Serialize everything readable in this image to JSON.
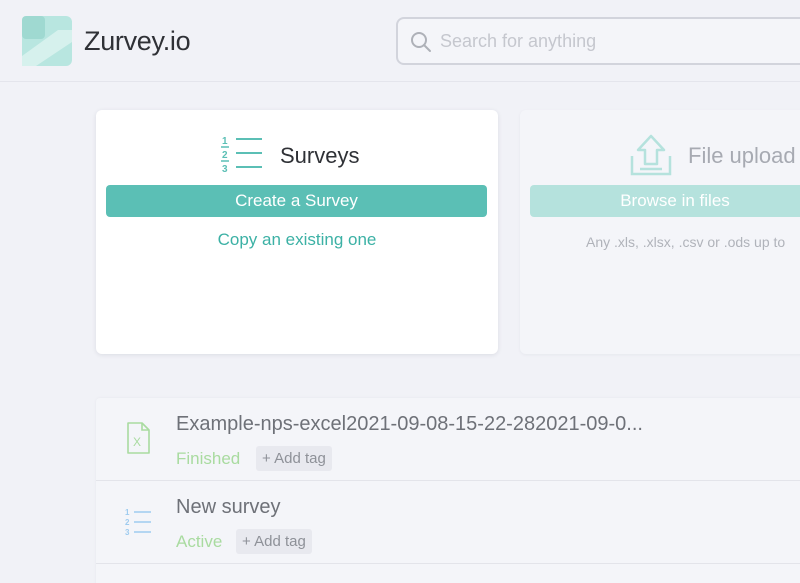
{
  "app": {
    "brand": "Zurvey.io",
    "colors": {
      "accent": "#5bbfb5",
      "accent_light": "#b5e2dd",
      "link": "#3cb1a5",
      "status_green": "#a9dba0"
    }
  },
  "header": {
    "search": {
      "placeholder": "Search for anything",
      "value": "",
      "icon": "search-icon"
    }
  },
  "cards": {
    "surveys": {
      "icon": "numbered-list-icon",
      "title": "Surveys",
      "create_label": "Create a Survey",
      "copy_label": "Copy an existing one"
    },
    "upload": {
      "icon": "upload-icon",
      "title": "File upload",
      "browse_label": "Browse in files",
      "hint": "Any .xls, .xlsx, .csv or .ods up to"
    }
  },
  "list": {
    "items": [
      {
        "icon": "excel-file-icon",
        "title": "Example-nps-excel2021-09-08-15-22-282021-09-0...",
        "status": "Finished",
        "tag_label": "+ Add tag"
      },
      {
        "icon": "numbered-list-icon",
        "title": "New survey",
        "status": "Active",
        "tag_label": "+ Add tag"
      }
    ]
  }
}
